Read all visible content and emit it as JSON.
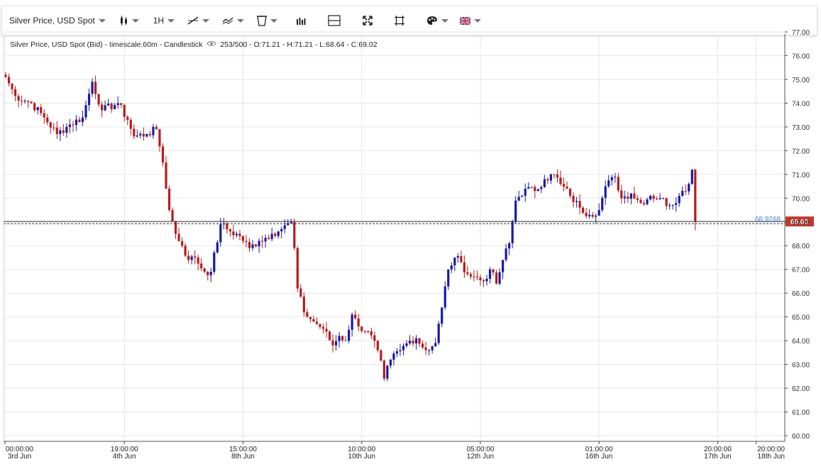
{
  "toolbar": {
    "symbol_label": "Silver Price, USD Spot",
    "timeframe_label": "1H",
    "icons": [
      "candlestick-type-icon",
      "line-tool-icon",
      "indicators-icon",
      "template-icon",
      "bar-chart-icon",
      "layout-icon",
      "fullscreen-icon",
      "zoom-fit-icon",
      "palette-icon",
      "uk-flag-icon"
    ]
  },
  "legend": {
    "title": "Silver Price, USD Spot (Bid) - timescale.60m - Candlestick",
    "stats": "253/500 - O:71.21 - H:71.21 - L:68.64 - C:69.02"
  },
  "price_tags": {
    "last": "69.02",
    "reference": "68.9268"
  },
  "colors": {
    "up": "#1a1aa6",
    "down": "#b81c1c",
    "grid": "#e6e6e6",
    "last_tag": "#c0392b",
    "reference_text": "#4a7fd4"
  },
  "chart_data": {
    "type": "candlestick",
    "title": "Silver Price, USD Spot (Bid) - timescale.60m - Candlestick",
    "ylim": [
      60,
      77
    ],
    "y_ticks": [
      "77.00",
      "76.00",
      "75.00",
      "74.00",
      "73.00",
      "72.00",
      "71.00",
      "70.00",
      "69.00",
      "68.00",
      "67.00",
      "66.00",
      "65.00",
      "64.00",
      "63.00",
      "62.00",
      "61.00",
      "60.00"
    ],
    "x_ticks": [
      {
        "time": "00:00:00",
        "date": "3rd Jun"
      },
      {
        "time": "19:00:00",
        "date": "4th Jun"
      },
      {
        "time": "15:00:00",
        "date": "8th Jun"
      },
      {
        "time": "10:00:00",
        "date": "10th Jun"
      },
      {
        "time": "05:00:00",
        "date": "12th Jun"
      },
      {
        "time": "01:00:00",
        "date": "16th Jun"
      },
      {
        "time": "20:00:00",
        "date": "17th Jun"
      },
      {
        "time": "20:00:00",
        "date": "18th Jun"
      }
    ],
    "x_tick_bar_index": [
      0,
      37,
      74,
      111,
      148,
      185,
      222,
      234
    ],
    "bars_shown": "253/500",
    "last": {
      "open": 71.21,
      "high": 71.21,
      "low": 68.64,
      "close": 69.02
    },
    "reference_level": 68.9268,
    "anchors": [
      [
        0,
        75.1
      ],
      [
        3,
        74.3
      ],
      [
        8,
        74.0
      ],
      [
        12,
        73.4
      ],
      [
        16,
        72.7
      ],
      [
        20,
        73.1
      ],
      [
        24,
        73.4
      ],
      [
        27,
        74.9
      ],
      [
        30,
        73.7
      ],
      [
        35,
        74.0
      ],
      [
        38,
        73.3
      ],
      [
        40,
        72.6
      ],
      [
        44,
        72.7
      ],
      [
        47,
        72.9
      ],
      [
        49,
        71.5
      ],
      [
        51,
        69.5
      ],
      [
        53,
        68.5
      ],
      [
        55,
        68.0
      ],
      [
        57,
        67.4
      ],
      [
        59,
        67.5
      ],
      [
        62,
        66.9
      ],
      [
        64,
        66.9
      ],
      [
        67,
        68.9
      ],
      [
        70,
        68.6
      ],
      [
        73,
        68.4
      ],
      [
        76,
        67.9
      ],
      [
        79,
        68.2
      ],
      [
        83,
        68.5
      ],
      [
        86,
        68.7
      ],
      [
        89,
        69.0
      ],
      [
        90,
        67.9
      ],
      [
        91,
        66.2
      ],
      [
        93,
        65.2
      ],
      [
        96,
        64.8
      ],
      [
        99,
        64.5
      ],
      [
        102,
        63.8
      ],
      [
        104,
        64.2
      ],
      [
        106,
        64.0
      ],
      [
        108,
        65.1
      ],
      [
        110,
        64.6
      ],
      [
        113,
        64.4
      ],
      [
        116,
        63.6
      ],
      [
        118,
        62.4
      ],
      [
        120,
        63.2
      ],
      [
        123,
        63.6
      ],
      [
        126,
        64.0
      ],
      [
        128,
        64.1
      ],
      [
        131,
        63.6
      ],
      [
        134,
        63.9
      ],
      [
        136,
        65.4
      ],
      [
        138,
        67.0
      ],
      [
        140,
        67.5
      ],
      [
        142,
        67.3
      ],
      [
        144,
        66.8
      ],
      [
        146,
        66.7
      ],
      [
        149,
        66.5
      ],
      [
        151,
        67.0
      ],
      [
        153,
        66.4
      ],
      [
        155,
        67.4
      ],
      [
        157,
        68.1
      ],
      [
        159,
        69.9
      ],
      [
        162,
        70.4
      ],
      [
        165,
        70.3
      ],
      [
        168,
        70.8
      ],
      [
        171,
        71.0
      ],
      [
        173,
        70.6
      ],
      [
        176,
        70.1
      ],
      [
        179,
        69.6
      ],
      [
        182,
        69.3
      ],
      [
        185,
        69.5
      ],
      [
        187,
        70.5
      ],
      [
        190,
        70.9
      ],
      [
        192,
        70.0
      ],
      [
        195,
        70.2
      ],
      [
        198,
        69.8
      ],
      [
        201,
        70.1
      ],
      [
        204,
        70.0
      ],
      [
        207,
        69.7
      ],
      [
        210,
        70.1
      ],
      [
        213,
        70.6
      ],
      [
        214,
        71.2
      ]
    ]
  }
}
